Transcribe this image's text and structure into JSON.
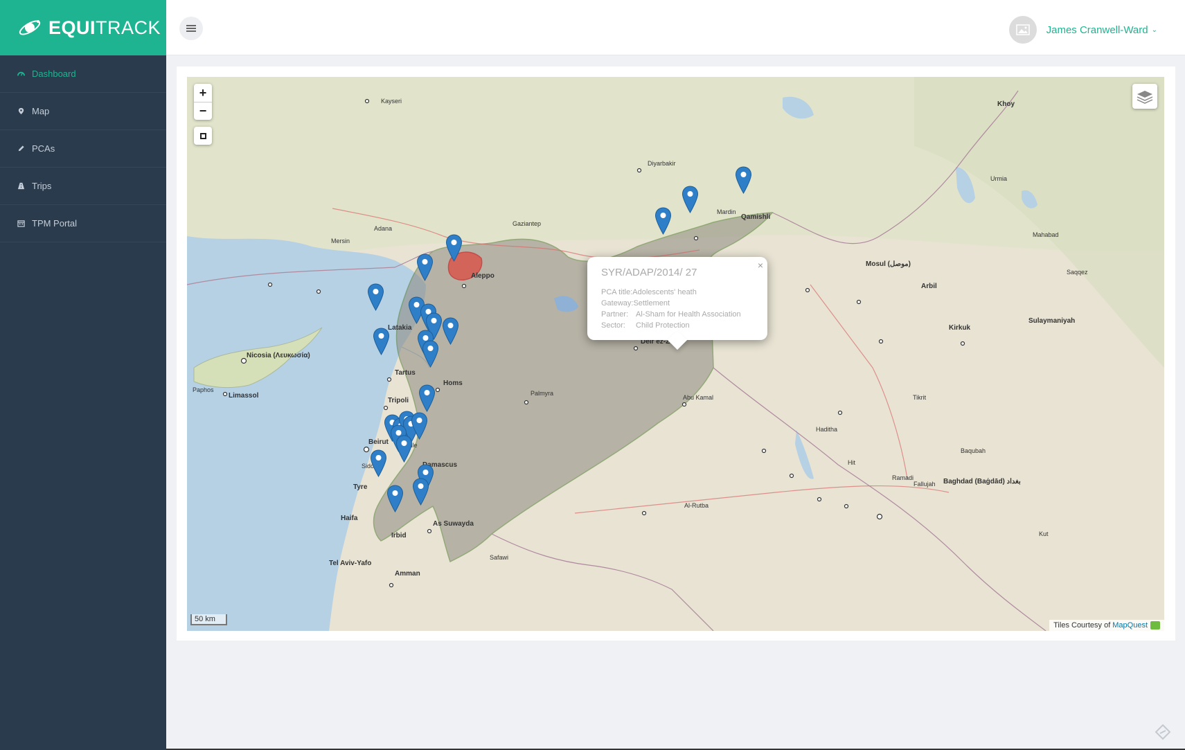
{
  "app": {
    "brand_bold": "EQUI",
    "brand_light": "TRACK"
  },
  "sidebar": {
    "items": [
      {
        "label": "Dashboard",
        "icon": "dashboard-icon",
        "active": true
      },
      {
        "label": "Map",
        "icon": "map-marker-icon",
        "active": false
      },
      {
        "label": "PCAs",
        "icon": "pencil-icon",
        "active": false
      },
      {
        "label": "Trips",
        "icon": "road-icon",
        "active": false
      },
      {
        "label": "TPM Portal",
        "icon": "calendar-icon",
        "active": false
      }
    ]
  },
  "header": {
    "user_name": "James Cranwell-Ward",
    "caret": "⌄"
  },
  "map": {
    "zoom_in": "+",
    "zoom_out": "−",
    "scale_label": "50 km",
    "attribution_text": "Tiles Courtesy of",
    "attribution_link": "MapQuest",
    "city_labels": [
      "Aleppo",
      "Latakia",
      "Tartus",
      "Homs",
      "Tripoli",
      "Beirut",
      "Damascus",
      "Palmyra",
      "Deir ez-Zor",
      "Abu Kamal",
      "As Suwayda",
      "Amman",
      "Irbid",
      "Haifa",
      "Tyre",
      "Sidon",
      "Zahle",
      "Nicosia (Λευκωσία)",
      "Limassol",
      "Paphos",
      "Mosul (موصل)",
      "Arbil",
      "Kirkuk",
      "Sulaymaniyah",
      "Baghdad (Baġdād) بغداد",
      "Qamishli",
      "Mardin",
      "Gaziantep",
      "Adana",
      "Mersin",
      "Kayseri",
      "Diyarbakir",
      "Ramadi",
      "Fallujah",
      "Tikrit",
      "Al-Rutba",
      "Haditha",
      "Hit",
      "Baqubah",
      "Khoy",
      "Urmia",
      "Mahabad",
      "Saqqez",
      "Kut",
      "Tel Aviv-Yafo",
      "Safawi"
    ]
  },
  "popup": {
    "title": "SYR/ADAP/2014/ 27",
    "close": "×",
    "rows": [
      {
        "key": "PCA title:",
        "value": "Adolescents' heath"
      },
      {
        "key": "Gateway:",
        "value": "Settlement"
      },
      {
        "key": "Partner:",
        "value": "Al-Sham for Health Association"
      },
      {
        "key": "Sector:",
        "value": "Child Protection"
      }
    ]
  },
  "colors": {
    "brand": "#1fb491",
    "sidebar": "#2a3b4d",
    "marker": "#2e7fc8",
    "highlight": "#e0443b"
  }
}
